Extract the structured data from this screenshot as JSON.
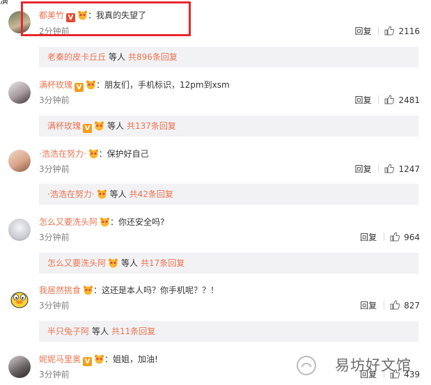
{
  "top_fragment": "演",
  "reply_label": "回复",
  "time_label": "分钟前",
  "deng": "等人",
  "comments": [
    {
      "user": "都美竹",
      "badge": "red",
      "pig": true,
      "text": "我真的失望了",
      "time": "2分钟前",
      "likes": "2116",
      "reply_user": "老秦的皮卡丘丘",
      "reply_count": "共896条回复"
    },
    {
      "user": "满杯玫瑰",
      "badge": "orange",
      "pig": true,
      "text": "朋友们，手机标识，12pm到xsm",
      "time": "3分钟前",
      "likes": "2481",
      "reply_user": "满杯玫瑰",
      "reply_badge": "orange",
      "reply_pig": true,
      "reply_count": "共137条回复"
    },
    {
      "user": "·浩浩在努力·",
      "badge": "",
      "pig": true,
      "text": "保护好自己",
      "time": "3分钟前",
      "likes": "1247",
      "reply_user": "·浩浩在努力·",
      "reply_pig": true,
      "reply_count": "共42条回复"
    },
    {
      "user": "怎么又要洗头阿",
      "badge": "",
      "pig": true,
      "text": "你还安全吗?",
      "time": "3分钟前",
      "likes": "964",
      "reply_user": "怎么又要洗头阿",
      "reply_pig": true,
      "reply_count": "共17条回复"
    },
    {
      "user": "我居然挑食",
      "badge": "",
      "pig": true,
      "text": "这还是本人吗？你手机呢？？！",
      "time": "3分钟前",
      "likes": "827",
      "reply_user": "半只兔子阿",
      "reply_count": "共11条回复"
    },
    {
      "user": "妮妮马里奥",
      "badge": "orange",
      "pig": true,
      "text": "姐姐，加油!",
      "time": "3分钟前",
      "likes": "439"
    }
  ],
  "watermark": "易坊好文馆",
  "colors": {
    "name": "#eb7350",
    "highlight_box": "#e8262b",
    "reply_bg": "#f2f2f5"
  }
}
